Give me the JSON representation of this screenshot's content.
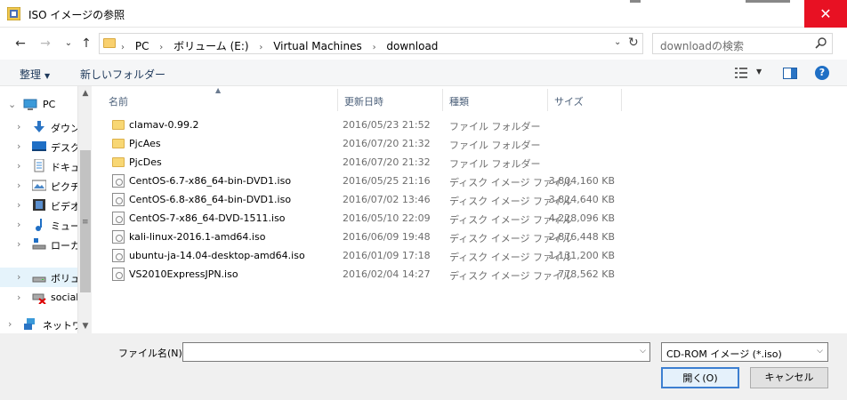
{
  "window": {
    "title": "ISO イメージの参照",
    "close_glyph": "✕"
  },
  "nav": {
    "back_glyph": "←",
    "forward_glyph": "→",
    "recent_glyph": "⌄",
    "up_glyph": "↑",
    "breadcrumb": [
      "PC",
      "ボリューム (E:)",
      "Virtual Machines",
      "download"
    ],
    "search_placeholder": "downloadの検索"
  },
  "toolbar": {
    "organize": "整理",
    "new_folder": "新しいフォルダー",
    "help_glyph": "?"
  },
  "sidebar": {
    "items": [
      {
        "label": "PC",
        "icon": "pc-icon",
        "expanded": true
      },
      {
        "label": "ダウンロ",
        "icon": "download-icon"
      },
      {
        "label": "デスクト",
        "icon": "desktop-icon"
      },
      {
        "label": "ドキュメ",
        "icon": "documents-icon"
      },
      {
        "label": "ピクチャ",
        "icon": "pictures-icon"
      },
      {
        "label": "ビデオ",
        "icon": "videos-icon"
      },
      {
        "label": "ミュージ",
        "icon": "music-icon"
      },
      {
        "label": "ローカル",
        "icon": "local-disk-icon"
      },
      {
        "label": "ボリュー",
        "icon": "volume-icon",
        "selected": true
      },
      {
        "label": "social",
        "icon": "network-drive-disconnected-icon"
      },
      {
        "label": "ネットワ",
        "icon": "network-icon"
      }
    ]
  },
  "columns": {
    "name": "名前",
    "date": "更新日時",
    "type": "種類",
    "size": "サイズ"
  },
  "files": [
    {
      "name": "clamav-0.99.2",
      "date": "2016/05/23 21:52",
      "type": "ファイル フォルダー",
      "size": "",
      "kind": "folder"
    },
    {
      "name": "PjcAes",
      "date": "2016/07/20 21:32",
      "type": "ファイル フォルダー",
      "size": "",
      "kind": "folder"
    },
    {
      "name": "PjcDes",
      "date": "2016/07/20 21:32",
      "type": "ファイル フォルダー",
      "size": "",
      "kind": "folder"
    },
    {
      "name": "CentOS-6.7-x86_64-bin-DVD1.iso",
      "date": "2016/05/25 21:16",
      "type": "ディスク イメージ ファイル",
      "size": "3,804,160 KB",
      "kind": "iso"
    },
    {
      "name": "CentOS-6.8-x86_64-bin-DVD1.iso",
      "date": "2016/07/02 13:46",
      "type": "ディスク イメージ ファイル",
      "size": "3,824,640 KB",
      "kind": "iso"
    },
    {
      "name": "CentOS-7-x86_64-DVD-1511.iso",
      "date": "2016/05/10 22:09",
      "type": "ディスク イメージ ファイル",
      "size": "4,228,096 KB",
      "kind": "iso"
    },
    {
      "name": "kali-linux-2016.1-amd64.iso",
      "date": "2016/06/09 19:48",
      "type": "ディスク イメージ ファイル",
      "size": "2,876,448 KB",
      "kind": "iso"
    },
    {
      "name": "ubuntu-ja-14.04-desktop-amd64.iso",
      "date": "2016/01/09 17:18",
      "type": "ディスク イメージ ファイル",
      "size": "1,131,200 KB",
      "kind": "iso"
    },
    {
      "name": "VS2010ExpressJPN.iso",
      "date": "2016/02/04 14:27",
      "type": "ディスク イメージ ファイル",
      "size": "778,562 KB",
      "kind": "iso"
    }
  ],
  "footer": {
    "filename_label": "ファイル名(N):",
    "filename_value": "",
    "filter_value": "CD-ROM イメージ (*.iso)",
    "open_label": "開く(O)",
    "cancel_label": "キャンセル"
  },
  "colors": {
    "close_red": "#e81123",
    "selection": "#e5f3fb",
    "accent": "#3c7fd1",
    "folder": "#f8d774"
  }
}
